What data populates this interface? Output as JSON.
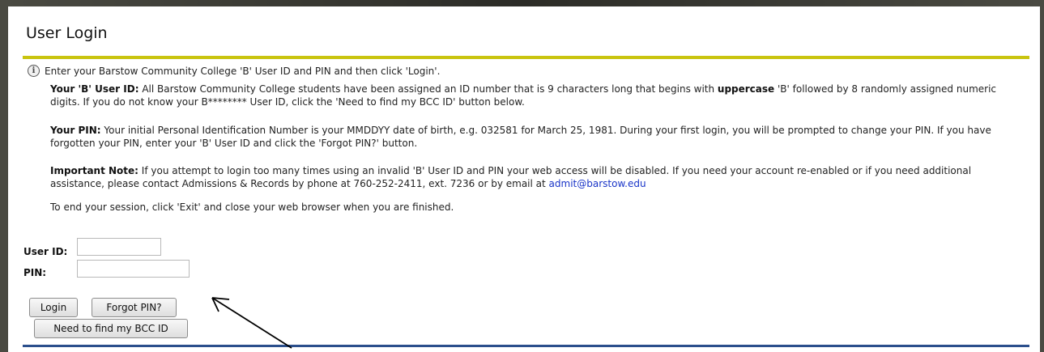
{
  "page": {
    "title": "User Login"
  },
  "intro": {
    "icon": "info-icon",
    "text": "Enter your Barstow Community College 'B' User ID and PIN and then click 'Login'."
  },
  "paragraphs": {
    "userid_heading": "Your 'B' User ID:",
    "userid_text_1": " All Barstow Community College students have been assigned an ID number that is 9 characters long that begins with ",
    "userid_emph": "uppercase",
    "userid_text_2": " 'B' followed by 8 randomly assigned numeric digits. If you do not know your B******** User ID, click the 'Need to find my BCC ID' button below.",
    "pin_heading": "Your PIN:",
    "pin_text": " Your initial Personal Identification Number is your MMDDYY date of birth, e.g. 032581 for March 25, 1981. During your first login, you will be prompted to change your PIN. If you have forgotten your PIN, enter your 'B' User ID and click the 'Forgot PIN?' button.",
    "note_heading": "Important Note:",
    "note_text": " If you attempt to login too many times using an invalid 'B' User ID and PIN your web access will be disabled. If you need your account re-enabled or if you need additional assistance, please contact Admissions & Records by phone at 760-252-2411, ext. 7236 or by email at ",
    "note_email": "admit@barstow.edu",
    "exit_text": "To end your session, click 'Exit' and close your web browser when you are finished."
  },
  "form": {
    "userid_label": "User ID:",
    "userid_value": "",
    "pin_label": "PIN:",
    "pin_value": ""
  },
  "buttons": {
    "login": "Login",
    "forgot_pin": "Forgot PIN?",
    "find_id": "Need to find my BCC ID"
  },
  "colors": {
    "accent_rule": "#c9c40f",
    "link": "#1a35c8",
    "bottom_rule": "#2b4f8c"
  },
  "annotation": {
    "icon": "arrow-annotation"
  }
}
